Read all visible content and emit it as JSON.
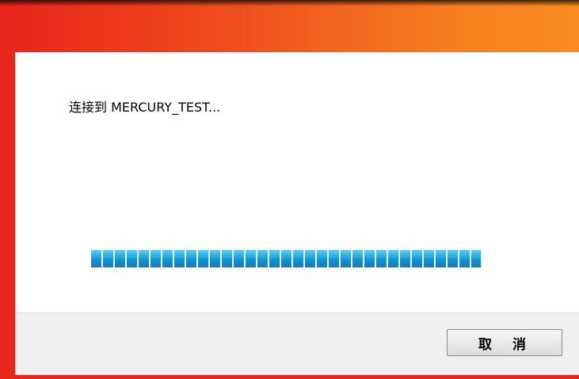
{
  "dialog": {
    "message": "连接到 MERCURY_TEST...",
    "progress_fraction": 1.0,
    "cancel_label": "取 消"
  }
}
